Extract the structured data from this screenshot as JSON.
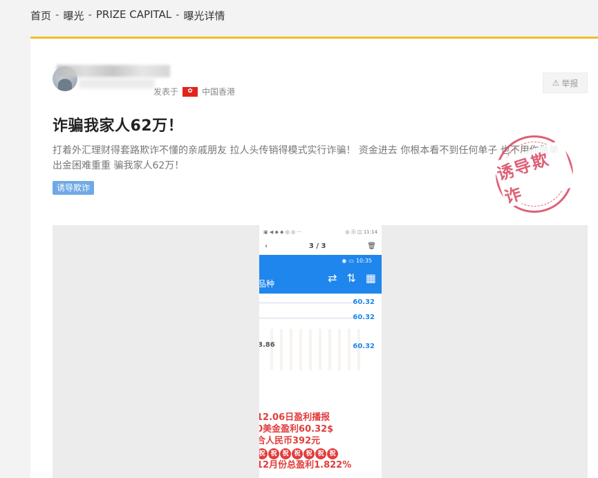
{
  "breadcrumb": {
    "items": [
      "首页",
      "曝光",
      "PRIZE CAPITAL",
      "曝光详情"
    ],
    "separator": "-"
  },
  "post": {
    "posted_label": "发表于",
    "location": "中国香港",
    "report_label": "举报",
    "title": "诈骗我家人62万！",
    "description": "打着外汇理财得套路欺诈不懂的亲戚朋友 拉人头传销得模式实行诈骗！ 资金进去 你根本看不到任何单子 也不用你做单 出金困难重重 骗我家人62万！",
    "tag": "诱导欺诈",
    "stamp_text": "诱导欺诈"
  },
  "phone": {
    "status_left": "▣ ◀ ◆ ◆ ◎ ◎ ···",
    "status_right": "◎ ⓑ ◫ 11:14",
    "viewer_counter": "3 / 3",
    "inner_time": "10:35",
    "header_label": "品种",
    "prices": [
      "60.32",
      "60.32",
      "60.32"
    ],
    "left_value": "3.86",
    "red_lines": [
      "12.06日盈利播报",
      "0美金盈利60.32$",
      "合人民币392元",
      "12月份总盈利1.822%"
    ],
    "zhu_char": "祝",
    "zhu_count": 7
  },
  "colors": {
    "accent_bar": "#f5bb2b",
    "tag_bg": "#6fa8e6",
    "stamp": "#d9455f",
    "phone_header": "#1e86ec",
    "red_text": "#e23c3c"
  }
}
